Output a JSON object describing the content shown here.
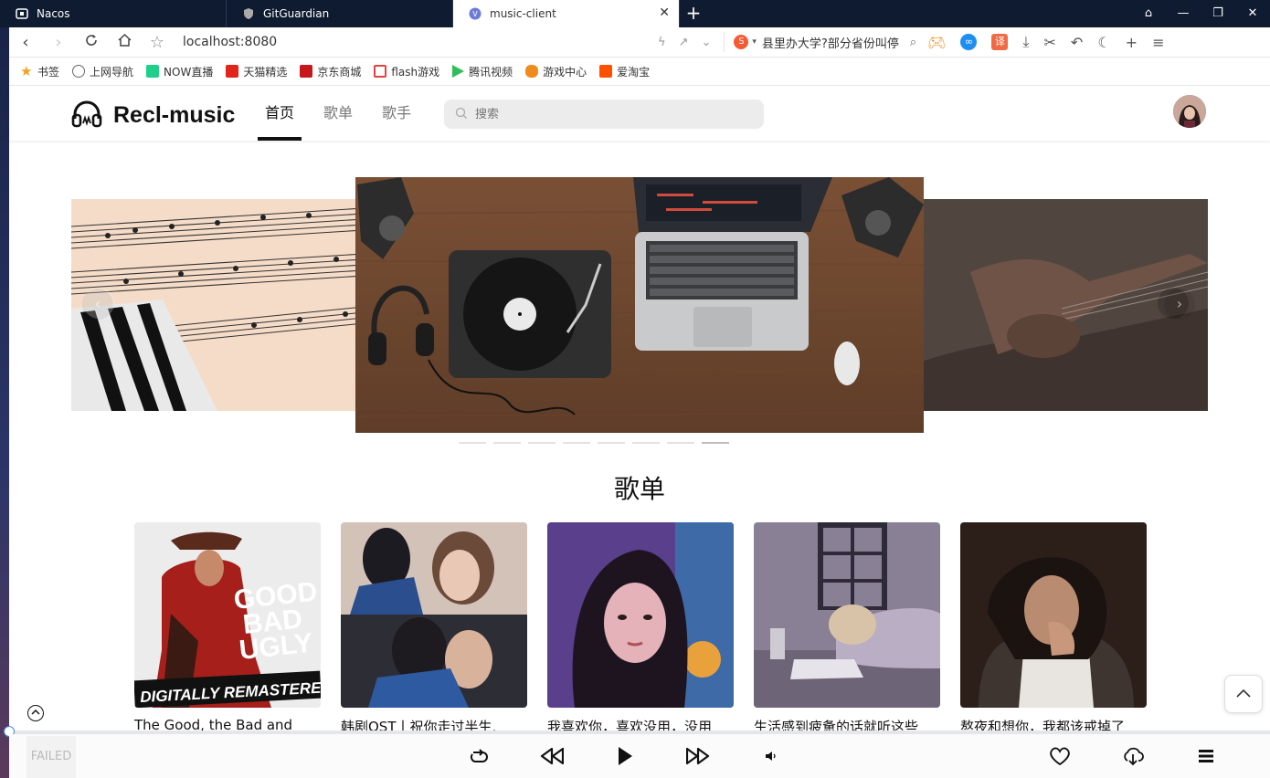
{
  "browser": {
    "tabs": [
      {
        "title": "Nacos",
        "active": false
      },
      {
        "title": "GitGuardian",
        "active": false
      },
      {
        "title": "music-client",
        "active": true
      }
    ],
    "url": "localhost:8080",
    "search_engine_text": "县里办大学?部分省份叫停",
    "bookmarks": [
      {
        "label": "书签",
        "icon": "star-icon",
        "color": "#f4a020"
      },
      {
        "label": "上网导航",
        "icon": "globe-icon",
        "color": "#666666"
      },
      {
        "label": "NOW直播",
        "icon": "now-icon",
        "color": "#1fcf8a"
      },
      {
        "label": "天猫精选",
        "icon": "tmall-icon",
        "color": "#e1251b"
      },
      {
        "label": "京东商城",
        "icon": "jd-icon",
        "color": "#c8161d"
      },
      {
        "label": "flash游戏",
        "icon": "flash-icon",
        "color": "#e84040"
      },
      {
        "label": "腾讯视频",
        "icon": "tencent-video-icon",
        "color": "#2fbf5a"
      },
      {
        "label": "游戏中心",
        "icon": "gamepad-icon",
        "color": "#f08c1e"
      },
      {
        "label": "爱淘宝",
        "icon": "taobao-icon",
        "color": "#ff5000"
      }
    ]
  },
  "header": {
    "brand": "Recl-music",
    "nav": [
      {
        "label": "首页",
        "active": true
      },
      {
        "label": "歌单",
        "active": false
      },
      {
        "label": "歌手",
        "active": false
      }
    ],
    "search_placeholder": "搜索"
  },
  "carousel": {
    "slide_count": 8,
    "active_index": 7
  },
  "playlists": {
    "title": "歌单",
    "items": [
      {
        "title": "The Good, the Bad and"
      },
      {
        "title": "韩剧OST丨祝你走过半生,"
      },
      {
        "title": "我喜欢你，喜欢没用，没用"
      },
      {
        "title": "生活感到疲惫的话就听这些"
      },
      {
        "title": "熬夜和想你，我都该戒掉了"
      }
    ]
  },
  "player": {
    "cover_status": "FAILED"
  },
  "colors": {
    "accent": "#111111",
    "progress_handle": "#3f8cff",
    "tabbar_bg": "#0f1b30"
  }
}
